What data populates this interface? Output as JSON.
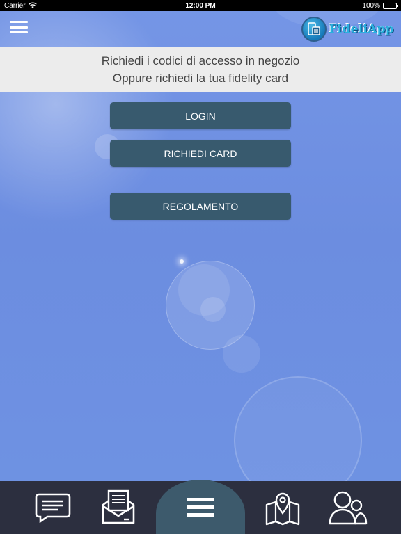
{
  "status_bar": {
    "carrier": "Carrier",
    "time": "12:00 PM",
    "battery": "100%",
    "battery_level": 1.0
  },
  "header": {
    "menu_icon": "hamburger-icon",
    "logo_text": "FideliApp",
    "logo_icon": "phone-card-icon"
  },
  "info": {
    "line1": "Richiedi i codici di accesso in negozio",
    "line2": "Oppure richiedi la tua fidelity card"
  },
  "buttons": {
    "login": "LOGIN",
    "request_card": "RICHIEDI CARD",
    "rules": "REGOLAMENTO"
  },
  "tab_bar": {
    "items": [
      {
        "icon": "chat-icon"
      },
      {
        "icon": "mail-icon"
      },
      {
        "icon": "menu-icon",
        "active": true
      },
      {
        "icon": "map-pin-icon"
      },
      {
        "icon": "users-icon"
      }
    ]
  },
  "colors": {
    "background": "#6f93e3",
    "button": "#385a6e",
    "banner": "#ececec",
    "tab_bar": "#2c2f3f",
    "tab_active": "#3d5a6c"
  }
}
